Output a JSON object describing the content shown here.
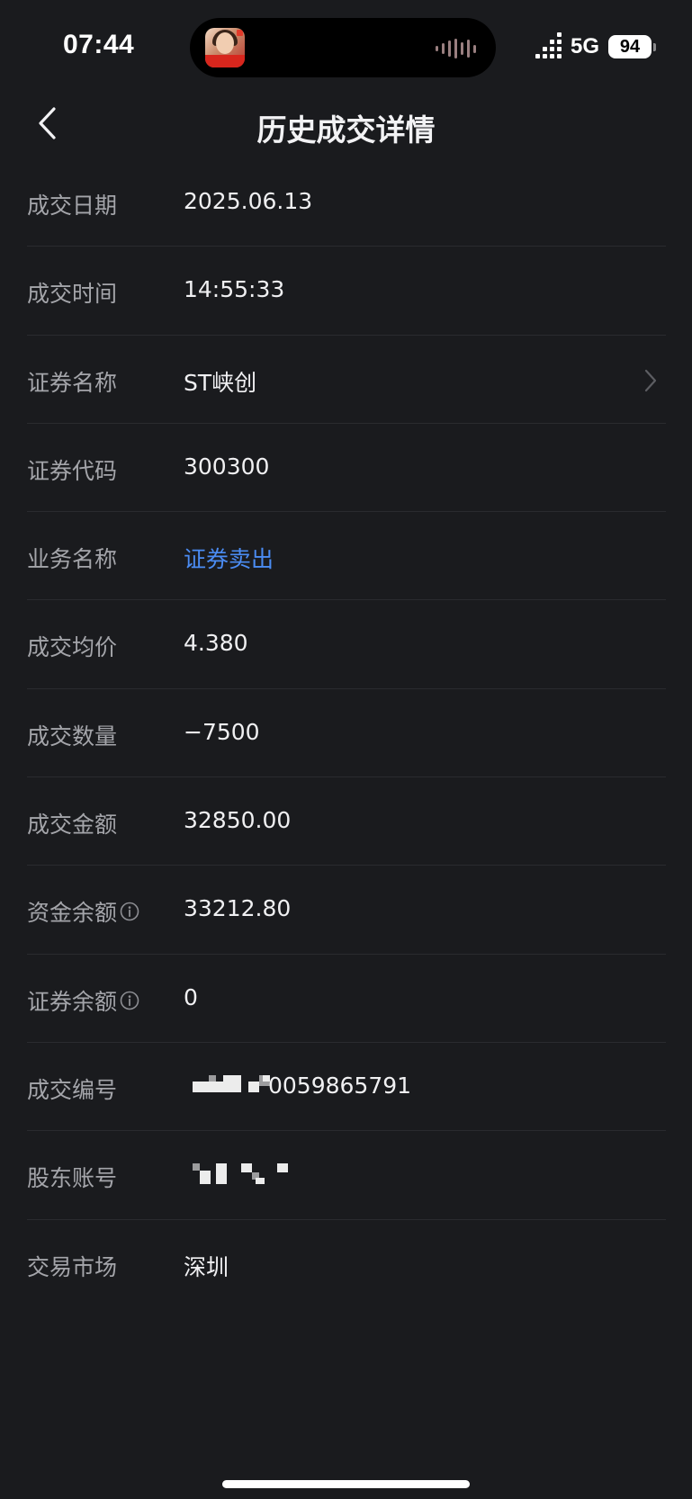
{
  "status_bar": {
    "time": "07:44",
    "network": "5G",
    "battery": "94"
  },
  "nav": {
    "title": "历史成交详情"
  },
  "details": {
    "trade_date": {
      "label": "成交日期",
      "value": "2025.06.13"
    },
    "trade_time": {
      "label": "成交时间",
      "value": "14:55:33"
    },
    "security_name": {
      "label": "证券名称",
      "value": "ST峡创"
    },
    "security_code": {
      "label": "证券代码",
      "value": "300300"
    },
    "business": {
      "label": "业务名称",
      "value": "证券卖出"
    },
    "avg_price": {
      "label": "成交均价",
      "value": "4.380"
    },
    "quantity": {
      "label": "成交数量",
      "value": "−7500"
    },
    "amount": {
      "label": "成交金额",
      "value": "32850.00"
    },
    "fund_balance": {
      "label": "资金余额",
      "value": "33212.80"
    },
    "sec_balance": {
      "label": "证券余额",
      "value": "0"
    },
    "trade_no": {
      "label": "成交编号",
      "value_suffix": "0059865791"
    },
    "holder_acct": {
      "label": "股东账号"
    },
    "market": {
      "label": "交易市场",
      "value": "深圳"
    }
  },
  "colors": {
    "background": "#1a1b1e",
    "label": "#a4a5aa",
    "value": "#f0f0f2",
    "link": "#4b8cf3",
    "divider": "#2a2b2f"
  },
  "icons": {
    "back": "chevron-left-icon",
    "detail": "chevron-right-icon",
    "info": "info-circle-icon"
  }
}
